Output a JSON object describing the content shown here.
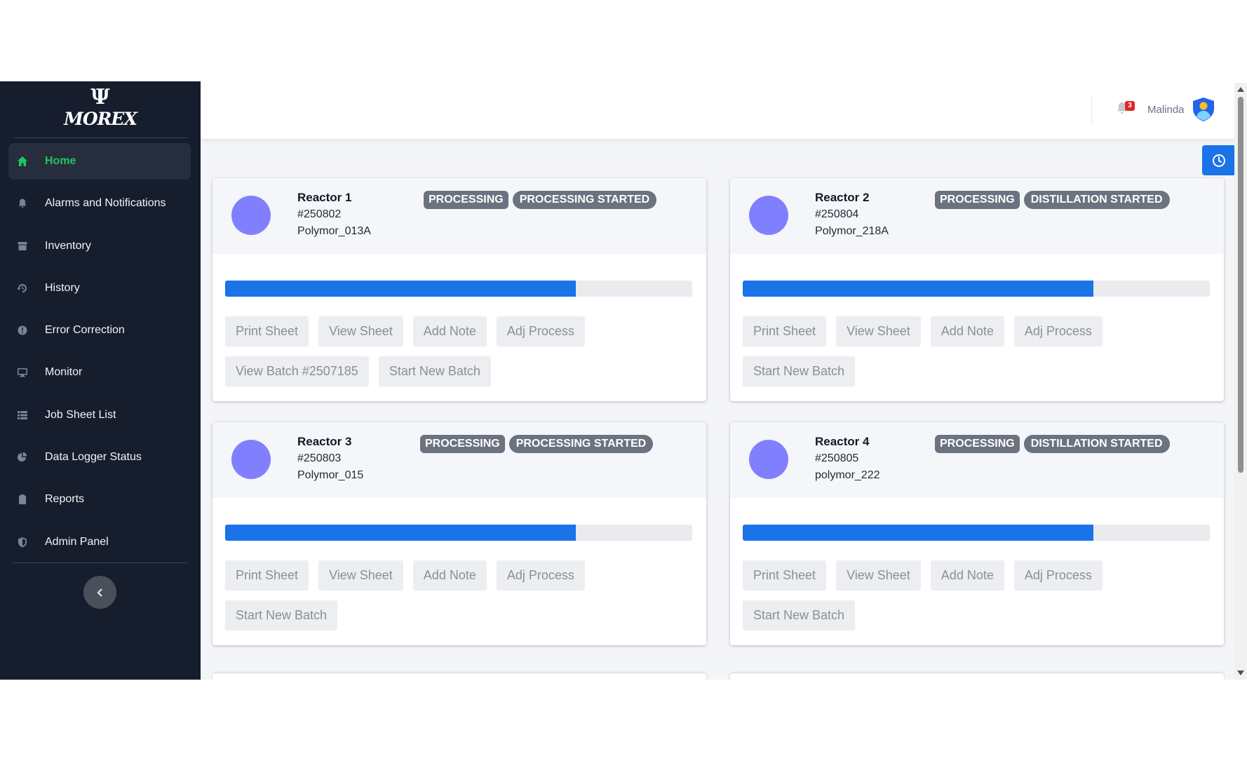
{
  "brand": {
    "mark": "Ψ",
    "name": "MOREX"
  },
  "sidebar": {
    "items": [
      {
        "label": "Home",
        "icon": "home-icon",
        "active": true
      },
      {
        "label": "Alarms and Notifications",
        "icon": "bell-icon"
      },
      {
        "label": "Inventory",
        "icon": "archive-icon"
      },
      {
        "label": "History",
        "icon": "history-icon"
      },
      {
        "label": "Error Correction",
        "icon": "alert-circle-icon"
      },
      {
        "label": "Monitor",
        "icon": "monitor-icon"
      },
      {
        "label": "Job Sheet List",
        "icon": "list-icon"
      },
      {
        "label": "Data Logger Status",
        "icon": "pie-chart-icon"
      },
      {
        "label": "Reports",
        "icon": "clipboard-icon"
      },
      {
        "label": "Admin Panel",
        "icon": "shield-icon"
      }
    ],
    "collapse_icon": "chevron-left-icon"
  },
  "header": {
    "notification_count": "3",
    "user_name": "Malinda"
  },
  "colors": {
    "accent": "#1a73e8",
    "active_nav": "#22c55e",
    "sidebar_bg": "#161d2d",
    "badge": "#dc2626",
    "reactor_circle": "#8080ff"
  },
  "reactors": [
    {
      "name": "Reactor 1",
      "batch": "#250802",
      "product": "Polymor_013A",
      "status": "PROCESSING",
      "stage": "PROCESSING STARTED",
      "progress": 0.75,
      "buttons": [
        "Print Sheet",
        "View Sheet",
        "Add Note",
        "Adj Process",
        "View Batch #2507185",
        "Start New Batch"
      ]
    },
    {
      "name": "Reactor 2",
      "batch": "#250804",
      "product": "Polymor_218A",
      "status": "PROCESSING",
      "stage": "DISTILLATION STARTED",
      "progress": 0.75,
      "buttons": [
        "Print Sheet",
        "View Sheet",
        "Add Note",
        "Adj Process",
        "Start New Batch"
      ]
    },
    {
      "name": "Reactor 3",
      "batch": "#250803",
      "product": "Polymor_015",
      "status": "PROCESSING",
      "stage": "PROCESSING STARTED",
      "progress": 0.75,
      "buttons": [
        "Print Sheet",
        "View Sheet",
        "Add Note",
        "Adj Process",
        "Start New Batch"
      ]
    },
    {
      "name": "Reactor 4",
      "batch": "#250805",
      "product": "polymor_222",
      "status": "PROCESSING",
      "stage": "DISTILLATION STARTED",
      "progress": 0.75,
      "buttons": [
        "Print Sheet",
        "View Sheet",
        "Add Note",
        "Adj Process",
        "Start New Batch"
      ]
    }
  ]
}
